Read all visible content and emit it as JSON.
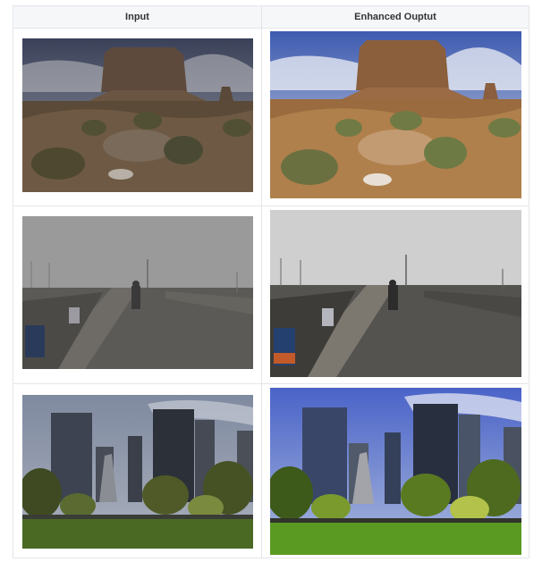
{
  "table": {
    "headers": [
      "Input",
      "Enhanced Ouptut"
    ]
  }
}
